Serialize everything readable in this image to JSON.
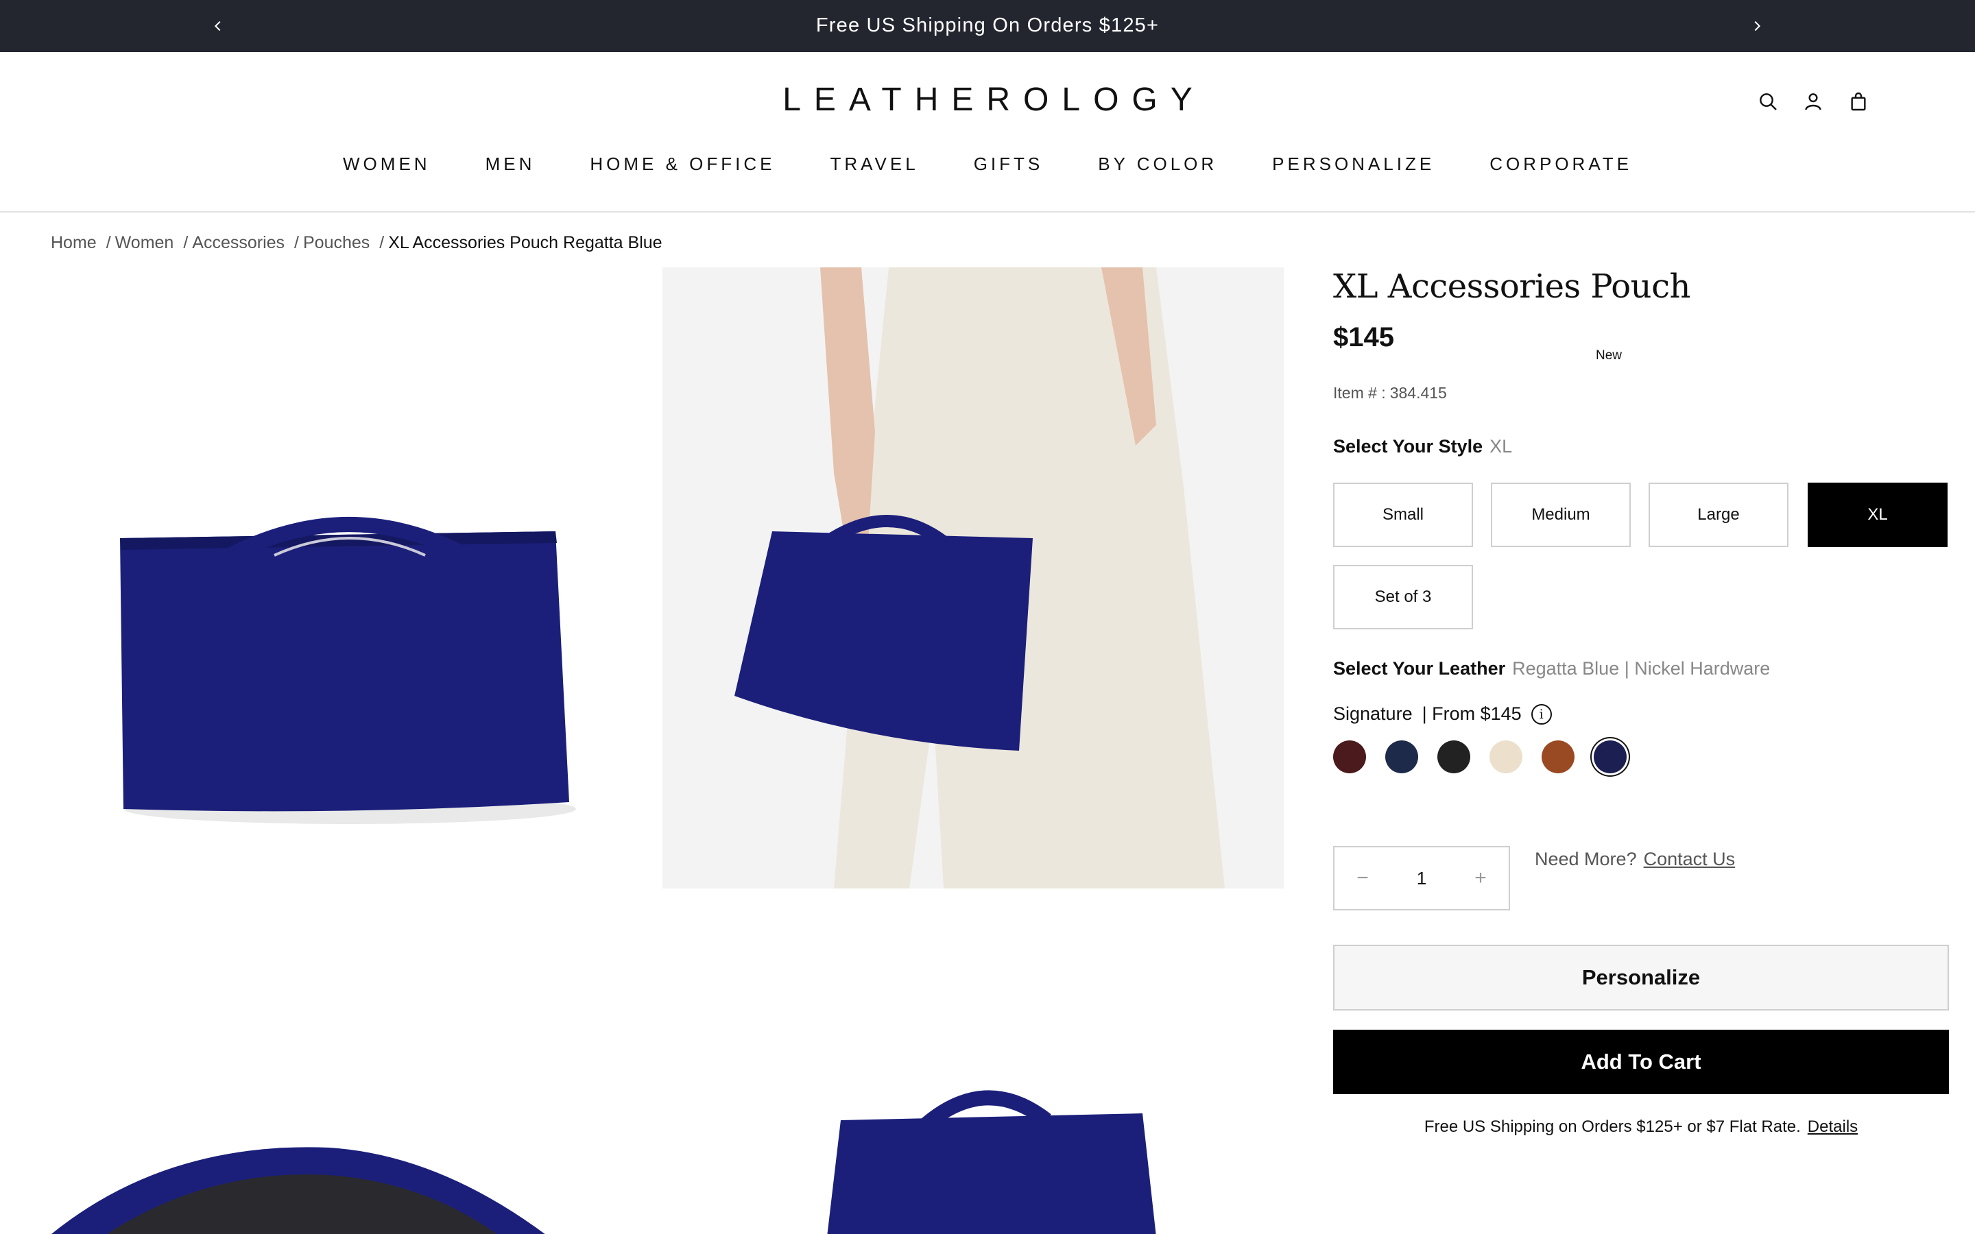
{
  "announcement": {
    "message": "Free US Shipping On Orders $125+",
    "prev_icon": "chevron-left-icon",
    "next_icon": "chevron-right-icon"
  },
  "header": {
    "logo": "LEATHEROLOGY",
    "icons": [
      "search-icon",
      "account-icon",
      "bag-icon"
    ],
    "nav": [
      "WOMEN",
      "MEN",
      "HOME & OFFICE",
      "TRAVEL",
      "GIFTS",
      "BY COLOR",
      "PERSONALIZE",
      "CORPORATE"
    ]
  },
  "breadcrumb": {
    "items": [
      "Home",
      "Women",
      "Accessories",
      "Pouches"
    ],
    "current": "XL Accessories Pouch Regatta Blue",
    "separator": "/"
  },
  "product": {
    "title": "XL Accessories Pouch",
    "price": "$145",
    "item_label": "Item # :",
    "item_number": "384.415",
    "style_label": "Select Your Style",
    "style_value": "XL",
    "styles": [
      "Small",
      "Medium",
      "Large",
      "XL",
      "Set of 3"
    ],
    "selected_style": "XL",
    "leather_label": "Select Your Leather",
    "leather_value": "Regatta Blue | Nickel Hardware",
    "collection": "Signature",
    "collection_price": "| From $145",
    "info_icon": "info-icon",
    "swatch_colors": [
      "#4a1a1c",
      "#1e2a4a",
      "#222222",
      "#ece0cc",
      "#9a4a22",
      "#1b1f52"
    ],
    "selected_swatch": 5,
    "new_badge": "New",
    "quantity": "1",
    "qty_minus": "−",
    "qty_plus": "+",
    "need_more": "Need More?",
    "contact_us": "Contact Us",
    "personalize_label": "Personalize",
    "add_to_cart_label": "Add To Cart",
    "shipping_note": "Free US Shipping on Orders $125+ or $7 Flat Rate.",
    "details_link": "Details"
  },
  "colors": {
    "announcement_bg": "#23262f",
    "bag_navy": "#1b1f7a",
    "cta_black": "#000000"
  }
}
